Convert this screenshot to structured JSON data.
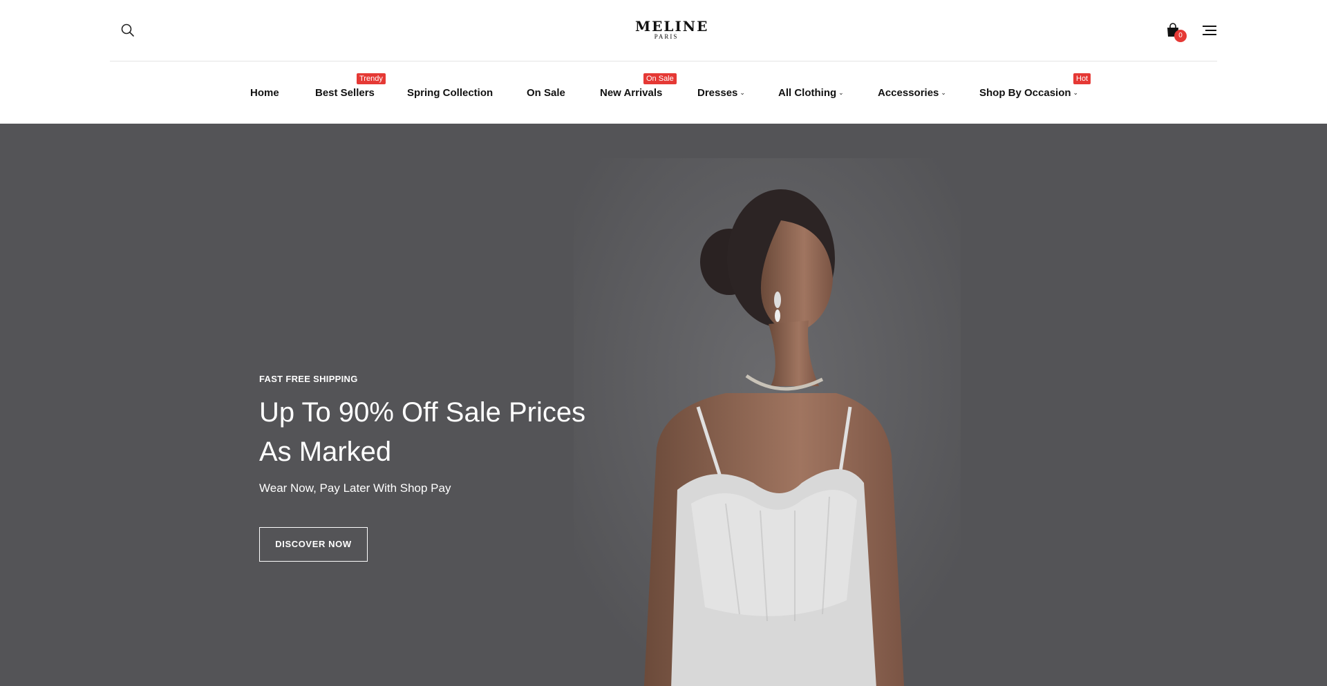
{
  "header": {
    "logo_main": "MELINE",
    "logo_sub": "PARIS",
    "cart_count": "0",
    "icons": {
      "search": "search-icon",
      "cart": "shopping-bag-icon",
      "menu": "hamburger-menu-icon"
    }
  },
  "nav": {
    "items": [
      {
        "label": "Home"
      },
      {
        "label": "Best Sellers",
        "badge": "Trendy"
      },
      {
        "label": "Spring Collection"
      },
      {
        "label": "On Sale"
      },
      {
        "label": "New Arrivals",
        "badge": "On Sale"
      },
      {
        "label": "Dresses",
        "dropdown": true
      },
      {
        "label": "All Clothing",
        "dropdown": true
      },
      {
        "label": "Accessories",
        "dropdown": true
      },
      {
        "label": "Shop By Occasion",
        "dropdown": true,
        "badge": "Hot"
      }
    ]
  },
  "hero": {
    "kicker": "FAST FREE SHIPPING",
    "title": "Up To 90% Off Sale Prices As Marked",
    "subtitle": "Wear Now, Pay Later With Shop Pay",
    "cta": "DISCOVER NOW"
  },
  "colors": {
    "badge": "#e53935",
    "hero_bg": "#545457",
    "text": "#111111"
  }
}
